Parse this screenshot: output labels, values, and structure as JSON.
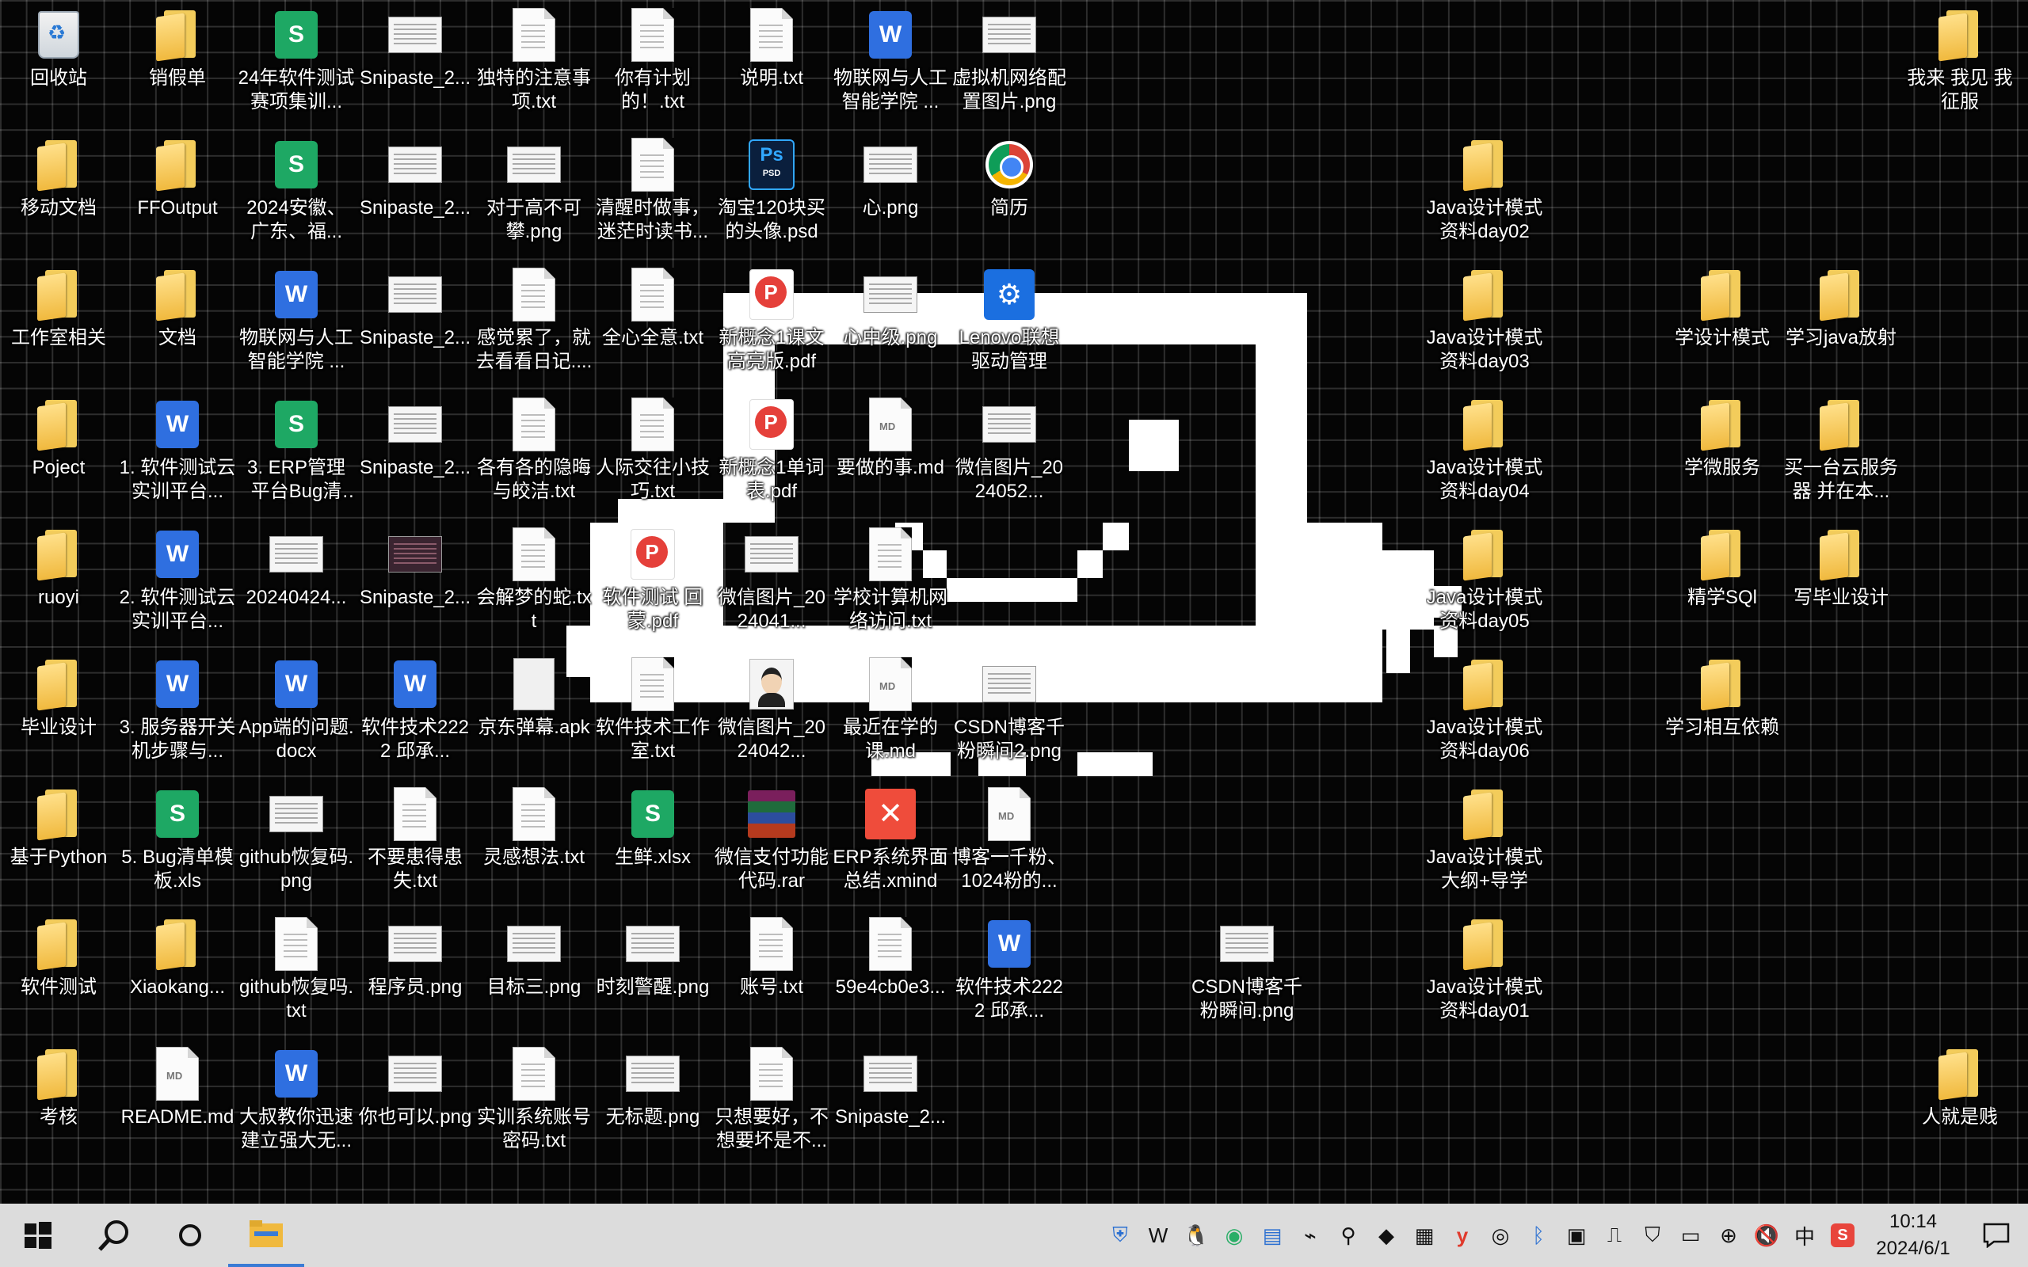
{
  "desktop": {
    "icons": [
      {
        "label": "回收站",
        "icon": "recycle-bin-icon",
        "kind": "recycle",
        "col": 0,
        "row": 0
      },
      {
        "label": "移动文档",
        "icon": "folder-icon",
        "kind": "folder",
        "col": 0,
        "row": 1
      },
      {
        "label": "工作室相关",
        "icon": "folder-icon",
        "kind": "folder",
        "col": 0,
        "row": 2
      },
      {
        "label": "Poject",
        "icon": "folder-icon",
        "kind": "folder",
        "col": 0,
        "row": 3
      },
      {
        "label": "ruoyi",
        "icon": "folder-icon",
        "kind": "folder",
        "col": 0,
        "row": 4
      },
      {
        "label": "毕业设计",
        "icon": "folder-icon",
        "kind": "folder",
        "col": 0,
        "row": 5
      },
      {
        "label": "基于Python",
        "icon": "folder-icon",
        "kind": "folder",
        "col": 0,
        "row": 6
      },
      {
        "label": "软件测试",
        "icon": "folder-icon",
        "kind": "folder",
        "col": 0,
        "row": 7
      },
      {
        "label": "考核",
        "icon": "folder-icon",
        "kind": "folder",
        "col": 0,
        "row": 8
      },
      {
        "label": "销假单",
        "icon": "folder-icon",
        "kind": "folder",
        "col": 1,
        "row": 0
      },
      {
        "label": "FFOutput",
        "icon": "folder-icon",
        "kind": "folder",
        "col": 1,
        "row": 1
      },
      {
        "label": "文档",
        "icon": "folder-icon",
        "kind": "folder",
        "col": 1,
        "row": 2
      },
      {
        "label": "1. 软件测试云实训平台...",
        "icon": "word-doc-icon",
        "kind": "word",
        "col": 1,
        "row": 3
      },
      {
        "label": "2. 软件测试云实训平台...",
        "icon": "word-doc-icon",
        "kind": "word",
        "col": 1,
        "row": 4
      },
      {
        "label": "3. 服务器开关机步骤与...",
        "icon": "word-doc-icon",
        "kind": "word",
        "col": 1,
        "row": 5
      },
      {
        "label": "5. Bug清单模板.xls",
        "icon": "spreadsheet-icon",
        "kind": "sheet",
        "col": 1,
        "row": 6
      },
      {
        "label": "Xiaokang...",
        "icon": "folder-icon",
        "kind": "folder",
        "col": 1,
        "row": 7
      },
      {
        "label": "README.md",
        "icon": "markdown-file-icon",
        "kind": "md",
        "col": 1,
        "row": 8
      },
      {
        "label": "24年软件测试赛项集训...",
        "icon": "spreadsheet-icon",
        "kind": "sheet",
        "col": 2,
        "row": 0
      },
      {
        "label": "2024安徽、广东、福...",
        "icon": "spreadsheet-icon",
        "kind": "sheet",
        "col": 2,
        "row": 1
      },
      {
        "label": "物联网与人工智能学院 ...",
        "icon": "word-doc-icon",
        "kind": "word",
        "col": 2,
        "row": 2
      },
      {
        "label": "3. ERP管理平台Bug清单....",
        "icon": "spreadsheet-icon",
        "kind": "sheet",
        "col": 2,
        "row": 3
      },
      {
        "label": "20240424...",
        "icon": "image-thumbnail-icon",
        "kind": "thumb",
        "col": 2,
        "row": 4
      },
      {
        "label": "App端的问题.docx",
        "icon": "word-doc-icon",
        "kind": "word",
        "col": 2,
        "row": 5
      },
      {
        "label": "github恢复码.png",
        "icon": "image-thumbnail-icon",
        "kind": "thumb",
        "col": 2,
        "row": 6
      },
      {
        "label": "github恢复吗.txt",
        "icon": "text-file-icon",
        "kind": "txt",
        "col": 2,
        "row": 7
      },
      {
        "label": "大叔教你迅速建立强大无...",
        "icon": "word-doc-icon",
        "kind": "word",
        "col": 2,
        "row": 8
      },
      {
        "label": "Snipaste_2...",
        "icon": "image-thumbnail-icon",
        "kind": "thumb",
        "col": 3,
        "row": 0
      },
      {
        "label": "Snipaste_2...",
        "icon": "image-thumbnail-icon",
        "kind": "thumb",
        "col": 3,
        "row": 1
      },
      {
        "label": "Snipaste_2...",
        "icon": "image-thumbnail-icon",
        "kind": "thumb",
        "col": 3,
        "row": 2
      },
      {
        "label": "Snipaste_2...",
        "icon": "image-thumbnail-icon",
        "kind": "thumb",
        "col": 3,
        "row": 3
      },
      {
        "label": "Snipaste_2...",
        "icon": "image-thumbnail-icon",
        "kind": "thumbdark",
        "col": 3,
        "row": 4
      },
      {
        "label": "软件技术2222 邱承...",
        "icon": "word-doc-icon",
        "kind": "word",
        "col": 3,
        "row": 5
      },
      {
        "label": "不要患得患失.txt",
        "icon": "text-file-icon",
        "kind": "txt",
        "col": 3,
        "row": 6
      },
      {
        "label": "程序员.png",
        "icon": "image-thumbnail-icon",
        "kind": "thumb",
        "col": 3,
        "row": 7
      },
      {
        "label": "你也可以.png",
        "icon": "image-thumbnail-icon",
        "kind": "thumb",
        "col": 3,
        "row": 8
      },
      {
        "label": "独特的注意事项.txt",
        "icon": "text-file-icon",
        "kind": "txt",
        "col": 4,
        "row": 0
      },
      {
        "label": "对于高不可攀.png",
        "icon": "image-thumbnail-icon",
        "kind": "thumb",
        "col": 4,
        "row": 1
      },
      {
        "label": "感觉累了，就去看看日记....",
        "icon": "text-file-icon",
        "kind": "txt",
        "col": 4,
        "row": 2
      },
      {
        "label": "各有各的隐晦与皎洁.txt",
        "icon": "text-file-icon",
        "kind": "txt",
        "col": 4,
        "row": 3
      },
      {
        "label": "会解梦的蛇.txt",
        "icon": "text-file-icon",
        "kind": "txt",
        "col": 4,
        "row": 4
      },
      {
        "label": "京东弹幕.apk",
        "icon": "apk-file-icon",
        "kind": "apk",
        "col": 4,
        "row": 5
      },
      {
        "label": "灵感想法.txt",
        "icon": "text-file-icon",
        "kind": "txt",
        "col": 4,
        "row": 6
      },
      {
        "label": "目标三.png",
        "icon": "image-thumbnail-icon",
        "kind": "thumb",
        "col": 4,
        "row": 7
      },
      {
        "label": "实训系统账号密码.txt",
        "icon": "text-file-icon",
        "kind": "txt",
        "col": 4,
        "row": 8
      },
      {
        "label": "你有计划的！.txt",
        "icon": "text-file-icon",
        "kind": "txt",
        "col": 5,
        "row": 0
      },
      {
        "label": "清醒时做事，迷茫时读书...",
        "icon": "text-file-icon",
        "kind": "txt",
        "col": 5,
        "row": 1
      },
      {
        "label": "全心全意.txt",
        "icon": "text-file-icon",
        "kind": "txt",
        "col": 5,
        "row": 2
      },
      {
        "label": "人际交往小技巧.txt",
        "icon": "text-file-icon",
        "kind": "txt",
        "col": 5,
        "row": 3
      },
      {
        "label": "软件测试 回蒙.pdf",
        "icon": "pdf-file-icon",
        "kind": "pdf",
        "col": 5,
        "row": 4
      },
      {
        "label": "软件技术工作室.txt",
        "icon": "text-file-icon",
        "kind": "txt",
        "col": 5,
        "row": 5
      },
      {
        "label": "生鲜.xlsx",
        "icon": "spreadsheet-icon",
        "kind": "sheet",
        "col": 5,
        "row": 6
      },
      {
        "label": "时刻警醒.png",
        "icon": "image-thumbnail-icon",
        "kind": "thumb",
        "col": 5,
        "row": 7
      },
      {
        "label": "无标题.png",
        "icon": "image-thumbnail-icon",
        "kind": "thumb",
        "col": 5,
        "row": 8
      },
      {
        "label": "说明.txt",
        "icon": "text-file-icon",
        "kind": "txt",
        "col": 6,
        "row": 0
      },
      {
        "label": "淘宝120块买的头像.psd",
        "icon": "photoshop-file-icon",
        "kind": "psd",
        "col": 6,
        "row": 1
      },
      {
        "label": "新概念1课文高亮版.pdf",
        "icon": "pdf-file-icon",
        "kind": "pdf",
        "col": 6,
        "row": 2
      },
      {
        "label": "新概念1单词表.pdf",
        "icon": "pdf-file-icon",
        "kind": "pdf",
        "col": 6,
        "row": 3
      },
      {
        "label": "微信图片_2024041...",
        "icon": "image-thumbnail-icon",
        "kind": "thumb",
        "col": 6,
        "row": 4
      },
      {
        "label": "微信图片_2024042...",
        "icon": "avatar-image-icon",
        "kind": "avatar",
        "col": 6,
        "row": 5
      },
      {
        "label": "微信支付功能代码.rar",
        "icon": "rar-archive-icon",
        "kind": "rar",
        "col": 6,
        "row": 6
      },
      {
        "label": "账号.txt",
        "icon": "text-file-icon",
        "kind": "txt",
        "col": 6,
        "row": 7
      },
      {
        "label": "只想要好，不想要坏是不...",
        "icon": "text-file-icon",
        "kind": "txt",
        "col": 6,
        "row": 8
      },
      {
        "label": "物联网与人工智能学院 ...",
        "icon": "word-doc-icon",
        "kind": "word",
        "col": 7,
        "row": 0
      },
      {
        "label": "心.png",
        "icon": "image-thumbnail-icon",
        "kind": "thumb",
        "col": 7,
        "row": 1
      },
      {
        "label": "心中级.png",
        "icon": "image-thumbnail-icon",
        "kind": "thumb",
        "col": 7,
        "row": 2
      },
      {
        "label": "要做的事.md",
        "icon": "markdown-file-icon",
        "kind": "md",
        "col": 7,
        "row": 3
      },
      {
        "label": "学校计算机网络访问.txt",
        "icon": "text-file-icon",
        "kind": "txt",
        "col": 7,
        "row": 4
      },
      {
        "label": "最近在学的课.md",
        "icon": "markdown-file-icon",
        "kind": "md",
        "col": 7,
        "row": 5
      },
      {
        "label": "ERP系统界面总结.xmind",
        "icon": "xmind-file-icon",
        "kind": "xmind",
        "col": 7,
        "row": 6
      },
      {
        "label": "59e4cb0e3...",
        "icon": "text-file-icon",
        "kind": "txt",
        "col": 7,
        "row": 7
      },
      {
        "label": "Snipaste_2...",
        "icon": "image-thumbnail-icon",
        "kind": "thumb",
        "col": 7,
        "row": 8
      },
      {
        "label": "虚拟机网络配置图片.png",
        "icon": "image-thumbnail-icon",
        "kind": "thumb",
        "col": 8,
        "row": 0
      },
      {
        "label": "简历",
        "icon": "chrome-shortcut-icon",
        "kind": "chrome",
        "col": 8,
        "row": 1
      },
      {
        "label": "Lenovo联想驱动管理",
        "icon": "lenovo-driver-icon",
        "kind": "lenovo",
        "col": 8,
        "row": 2
      },
      {
        "label": "微信图片_2024052...",
        "icon": "image-thumbnail-icon",
        "kind": "thumb",
        "col": 8,
        "row": 3
      },
      {
        "label": "CSDN博客千粉瞬间2.png",
        "icon": "image-thumbnail-icon",
        "kind": "thumb",
        "col": 8,
        "row": 5
      },
      {
        "label": "博客一千粉、1024粉的...",
        "icon": "markdown-file-icon",
        "kind": "md",
        "col": 8,
        "row": 6
      },
      {
        "label": "软件技术2222 邱承...",
        "icon": "word-doc-icon",
        "kind": "word",
        "col": 8,
        "row": 7
      },
      {
        "label": "CSDN博客千粉瞬间.png",
        "icon": "image-thumbnail-icon",
        "kind": "thumb",
        "col": 10,
        "row": 7
      },
      {
        "label": "Java设计模式资料day02",
        "icon": "folder-icon",
        "kind": "folder",
        "col": 12,
        "row": 1
      },
      {
        "label": "Java设计模式资料day03",
        "icon": "folder-icon",
        "kind": "folder",
        "col": 12,
        "row": 2
      },
      {
        "label": "Java设计模式资料day04",
        "icon": "folder-icon",
        "kind": "folder",
        "col": 12,
        "row": 3
      },
      {
        "label": "Java设计模式资料day05",
        "icon": "folder-icon",
        "kind": "folder",
        "col": 12,
        "row": 4
      },
      {
        "label": "Java设计模式资料day06",
        "icon": "folder-icon",
        "kind": "folder",
        "col": 12,
        "row": 5
      },
      {
        "label": "Java设计模式大纲+导学",
        "icon": "folder-icon",
        "kind": "folder",
        "col": 12,
        "row": 6
      },
      {
        "label": "Java设计模式资料day01",
        "icon": "folder-icon",
        "kind": "folder",
        "col": 12,
        "row": 7
      },
      {
        "label": "学设计模式",
        "icon": "folder-icon",
        "kind": "folder",
        "col": 14,
        "row": 2
      },
      {
        "label": "学微服务",
        "icon": "folder-icon",
        "kind": "folder",
        "col": 14,
        "row": 3
      },
      {
        "label": "精学SQl",
        "icon": "folder-icon",
        "kind": "folder",
        "col": 14,
        "row": 4
      },
      {
        "label": "学习相互依赖",
        "icon": "folder-icon",
        "kind": "folder",
        "col": 14,
        "row": 5
      },
      {
        "label": "学习java放射",
        "icon": "folder-icon",
        "kind": "folder",
        "col": 15,
        "row": 2
      },
      {
        "label": "买一台云服务器 并在本...",
        "icon": "folder-icon",
        "kind": "folder",
        "col": 15,
        "row": 3
      },
      {
        "label": "写毕业设计",
        "icon": "folder-icon",
        "kind": "folder",
        "col": 15,
        "row": 4
      },
      {
        "label": "我来 我见 我征服",
        "icon": "folder-icon",
        "kind": "folder",
        "col": 16,
        "row": 0
      },
      {
        "label": "人就是贱",
        "icon": "folder-icon",
        "kind": "folder",
        "col": 16,
        "row": 8
      }
    ]
  },
  "taskbar": {
    "start_icon": "windows-start-icon",
    "search_icon": "search-icon",
    "cortana_icon": "cortana-circle-icon",
    "explorer_icon": "file-explorer-icon",
    "tray_icons": [
      "shield-icon",
      "wps-icon",
      "qq-icon",
      "wechat-icon",
      "notepad-icon",
      "satellite-icon",
      "search-tool-icon",
      "cat-app-icon",
      "puzzle-app-icon",
      "youdao-icon",
      "steam-icon",
      "bluetooth-icon",
      "nvidia-icon",
      "usb-icon",
      "security-icon",
      "battery-icon",
      "network-icon",
      "volume-muted-icon"
    ],
    "ime_label": "中",
    "app_tray_icon": "red-app-icon",
    "clock_time": "10:14",
    "clock_date": "2024/6/1",
    "notification_icon": "action-center-icon"
  }
}
